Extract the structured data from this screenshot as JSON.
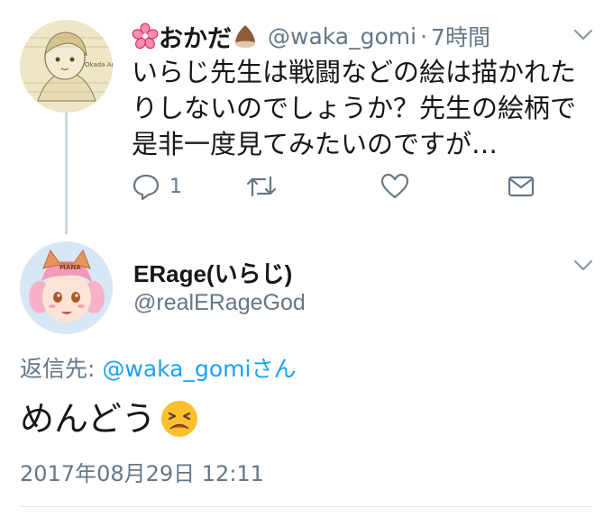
{
  "tweet1": {
    "display_name": "おかだ",
    "handle": "@waka_gomi",
    "separator": "·",
    "time": "7時間",
    "text": "いらじ先生は戦闘などの絵は描かれたりしないのでしょうか？先生の絵柄で是非一度見てみたいのですが…",
    "reply_count": "1",
    "avatar_signature": "Okada Art"
  },
  "tweet2": {
    "display_name": "ERage(いらじ)",
    "handle": "@realERageGod",
    "reply_prefix": "返信先: ",
    "reply_target": "@waka_gomi",
    "reply_suffix": "さん",
    "text": "めんどう",
    "timestamp": "2017年08月29日 12:11",
    "avatar_hat_text": "MANA"
  },
  "icons": {
    "name_prefix_emoji": "cherry-blossom",
    "name_suffix_emoji": "chestnut",
    "body_emoji": "persevering-face",
    "actions": [
      "reply-icon",
      "retweet-icon",
      "like-icon",
      "direct-message-icon"
    ]
  },
  "colors": {
    "link": "#1da1f2",
    "muted": "#657786",
    "thread_line": "#ccd6dd"
  }
}
